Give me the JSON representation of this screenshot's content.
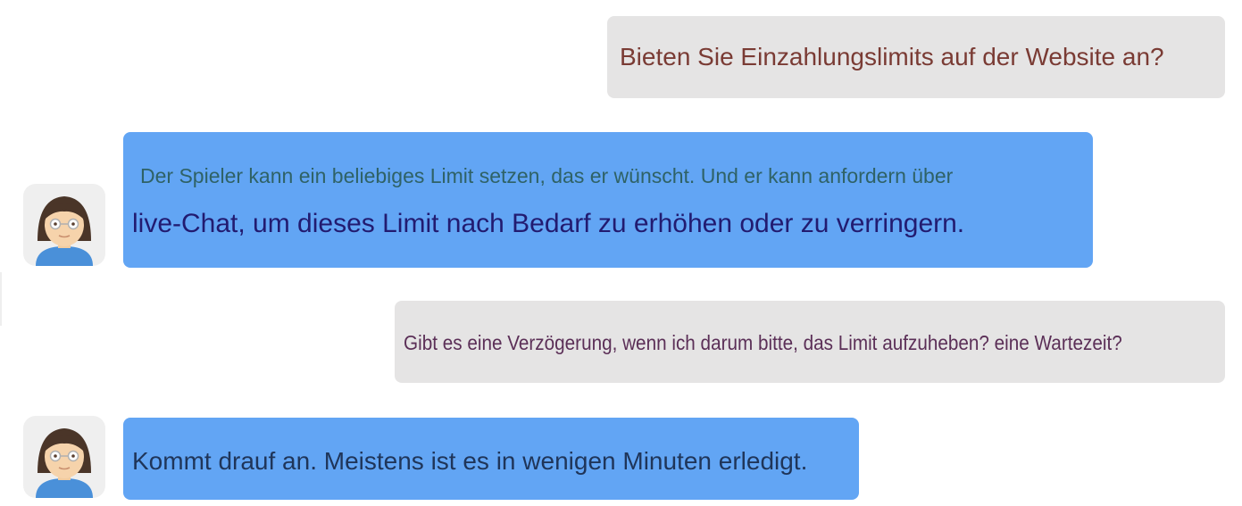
{
  "colors": {
    "user_bubble": "#e5e4e4",
    "agent_bubble": "#62a5f4",
    "user_text": "#7a3b34",
    "agent_text_soft": "#2f6266",
    "agent_text_strong": "#221b70"
  },
  "messages": [
    {
      "sender": "user",
      "lines": [
        "Bieten Sie Einzahlungslimits auf der Website an?"
      ]
    },
    {
      "sender": "agent",
      "avatar_icon": "agent-avatar-icon",
      "lines": [
        "Der Spieler kann ein beliebiges Limit setzen, das er wünscht. Und er kann anfordern über",
        "live-Chat, um dieses Limit nach Bedarf zu erhöhen oder zu verringern."
      ]
    },
    {
      "sender": "user",
      "lines": [
        "Gibt es eine Verzögerung, wenn ich darum bitte, das Limit aufzuheben? eine Wartezeit?"
      ]
    },
    {
      "sender": "agent",
      "avatar_icon": "agent-avatar-icon",
      "lines": [
        "Kommt drauf an. Meistens ist es in wenigen Minuten erledigt."
      ]
    }
  ]
}
